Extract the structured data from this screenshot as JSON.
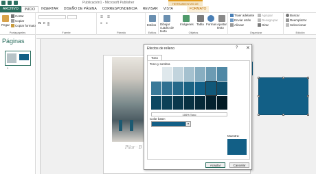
{
  "window": {
    "title": "Publicación1 - Microsoft Publisher",
    "context_group": "HERRAMIENTAS DE DIBUJO"
  },
  "tabs": [
    {
      "label": "ARCHIVO"
    },
    {
      "label": "INICIO"
    },
    {
      "label": "INSERTAR"
    },
    {
      "label": "DISEÑO DE PÁGINA"
    },
    {
      "label": "CORRESPONDENCIA"
    },
    {
      "label": "REVISAR"
    },
    {
      "label": "VISTA"
    },
    {
      "label": "FORMATO"
    }
  ],
  "ribbon": {
    "clipboard": {
      "paste": "Pegar",
      "cut": "Cortar",
      "copy": "Copiar",
      "format_painter": "Copiar formato",
      "group": "Portapapeles"
    },
    "font_group": "Fuente",
    "paragraph_group": "Párrafo",
    "styles": {
      "label": "Estilos",
      "group": "Estilos"
    },
    "objects": {
      "draw_textbox": "Dibujar cuadro de texto",
      "pictures": "Imágenes",
      "table": "Tabla",
      "shapes": "Formas",
      "wrap": "Ajustar texto",
      "group": "Objetos"
    },
    "arrange": {
      "bring_forward": "Traer adelante",
      "send_backward": "Enviar atrás",
      "align": "Alinear",
      "group_btn": "Agrupar",
      "ungroup": "Desagrupar",
      "rotate": "Girar",
      "group": "Organizar"
    },
    "editing": {
      "find": "Buscar",
      "replace": "Reemplazar",
      "select": "Seleccionar",
      "group": "Edición"
    }
  },
  "pages_pane": {
    "title": "Páginas",
    "page_number": "1"
  },
  "signature_text": "Pilar · B",
  "dialog": {
    "title": "Efectos de relleno",
    "help": "?",
    "close": "✕",
    "tab": "Tono",
    "section_label": "Tono y sombra",
    "percent_label": "100% Tono",
    "base_color_label": "Color base:",
    "sample_label": "Muestra:",
    "accept": "Aceptar",
    "cancel": "Cancelar",
    "swatch_rows": [
      [
        "#ffffff",
        "#dfe8ec",
        "#c2d4dd",
        "#a5c1cf",
        "#88aec1",
        "#6c9bb3",
        "#4f88a5"
      ],
      [
        "#3a7a99",
        "#2f7091",
        "#256889",
        "#1a6283",
        "#125f86",
        "#115879",
        "#0f506e"
      ],
      [
        "#0d4862",
        "#0c4157",
        "#0a384c",
        "#083142",
        "#062938",
        "#04212e",
        "#021a24"
      ]
    ],
    "selected_swatch": [
      1,
      5
    ]
  },
  "colors": {
    "accent": "#2b6e5f",
    "shape_fill": "#125f86",
    "context": "#e39b1b"
  }
}
